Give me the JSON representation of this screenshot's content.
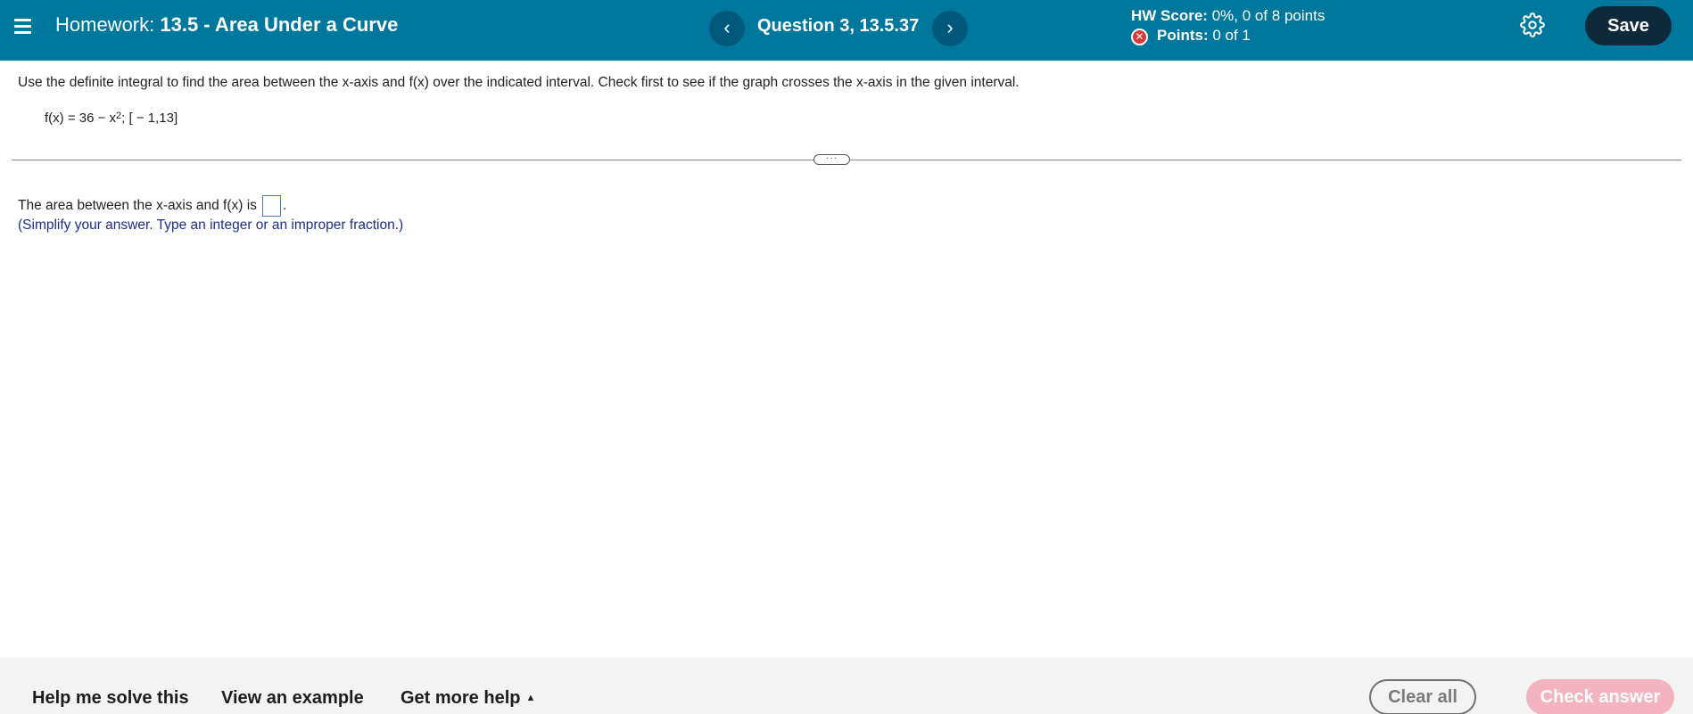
{
  "header": {
    "hw_prefix": "Homework:",
    "hw_name": "13.5 - Area Under a Curve",
    "prev_label": "‹",
    "next_label": "›",
    "question_label": "Question 3, 13.5.37",
    "hw_score_label": "HW Score:",
    "hw_score_value": "0%, 0 of 8 points",
    "points_label": "Points:",
    "points_value": "0 of 1",
    "save_label": "Save",
    "icons": [
      "menu-icon",
      "chevron-left-icon",
      "chevron-right-icon",
      "incorrect-x-icon",
      "gear-icon"
    ],
    "colors": {
      "header_bg": "#00779c",
      "save_bg": "#0e2a3a",
      "incorrect": "#d9393b"
    }
  },
  "question": {
    "instruction": "Use the definite integral to find the area between the x-axis and f(x) over the indicated interval. Check first to see if the graph crosses the x-axis in the given interval.",
    "formula_lhs": "f(x) = 36 − x",
    "formula_exponent": "2",
    "formula_rest": "; [ − 1,13]",
    "expand_label": "···",
    "answer_prefix": "The area between the x-axis and f(x) is",
    "answer_value": "",
    "answer_suffix": ".",
    "hint": "(Simplify your answer. Type an integer or an improper fraction.)"
  },
  "footer": {
    "help_solve": "Help me solve this",
    "view_example": "View an example",
    "more_help": "Get more help",
    "more_help_caret": "▲",
    "clear_all": "Clear all",
    "check_answer": "Check answer",
    "colors": {
      "check_bg": "#f4b3c0",
      "footer_bg": "#f3f3f3"
    }
  }
}
